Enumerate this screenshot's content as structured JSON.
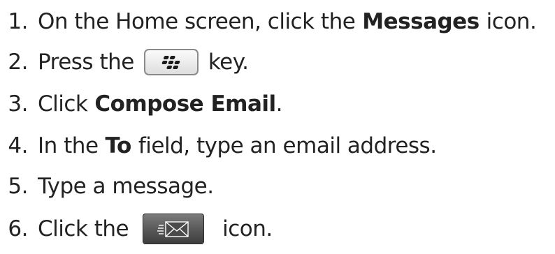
{
  "steps": [
    {
      "number": "1.",
      "text_before": "On the Home screen, click the",
      "bold": "Messages",
      "text_after": "icon."
    },
    {
      "number": "2.",
      "text_before": "Press the",
      "icon": "blackberry-menu-key-icon",
      "text_after": "key."
    },
    {
      "number": "3.",
      "text_before": "Click",
      "bold": "Compose Email",
      "text_after": "."
    },
    {
      "number": "4.",
      "text_before": "In the",
      "bold": "To",
      "text_after": "field, type an email address."
    },
    {
      "number": "5.",
      "text_before": "Type a message."
    },
    {
      "number": "6.",
      "text_before": "Click the",
      "icon": "send-envelope-icon",
      "text_after": "icon."
    }
  ],
  "colors": {
    "text": "#222222",
    "key_border": "#8a8a8a",
    "send_button_dark": "#3e3e3e",
    "send_button_light": "#7b7b7b"
  }
}
